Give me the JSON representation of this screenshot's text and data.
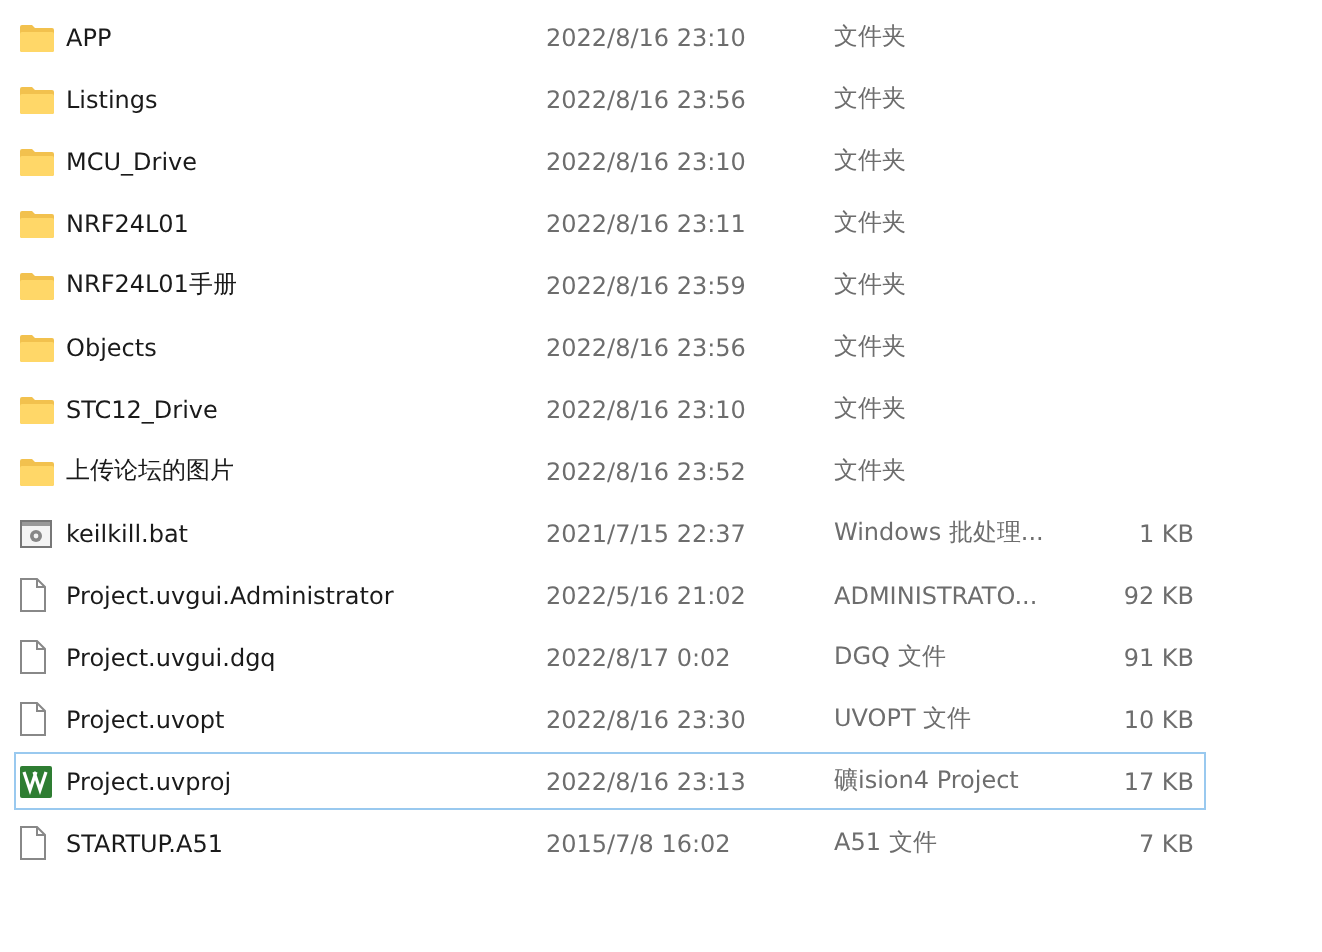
{
  "files": [
    {
      "kind": "folder",
      "name": "APP",
      "date": "2022/8/16 23:10",
      "type": "文件夹",
      "focused": false
    },
    {
      "kind": "folder",
      "name": "Listings",
      "date": "2022/8/16 23:56",
      "type": "文件夹",
      "focused": false
    },
    {
      "kind": "folder",
      "name": "MCU_Drive",
      "date": "2022/8/16 23:10",
      "type": "文件夹",
      "focused": false
    },
    {
      "kind": "folder",
      "name": "NRF24L01",
      "date": "2022/8/16 23:11",
      "type": "文件夹",
      "focused": false
    },
    {
      "kind": "folder",
      "name": "NRF24L01手册",
      "date": "2022/8/16 23:59",
      "type": "文件夹",
      "focused": false
    },
    {
      "kind": "folder",
      "name": "Objects",
      "date": "2022/8/16 23:56",
      "type": "文件夹",
      "focused": false
    },
    {
      "kind": "folder",
      "name": "STC12_Drive",
      "date": "2022/8/16 23:10",
      "type": "文件夹",
      "focused": false
    },
    {
      "kind": "folder",
      "name": "上传论坛的图片",
      "date": "2022/8/16 23:52",
      "type": "文件夹",
      "focused": false
    },
    {
      "kind": "batch",
      "name": "keilkill.bat",
      "date": "2021/7/15 22:37",
      "type": "Windows 批处理...",
      "size": "1 KB",
      "focused": false
    },
    {
      "kind": "file",
      "name": "Project.uvgui.Administrator",
      "date": "2022/5/16 21:02",
      "type": "ADMINISTRATO...",
      "size": "92 KB",
      "focused": false
    },
    {
      "kind": "file",
      "name": "Project.uvgui.dgq",
      "date": "2022/8/17 0:02",
      "type": "DGQ 文件",
      "size": "91 KB",
      "focused": false
    },
    {
      "kind": "file",
      "name": "Project.uvopt",
      "date": "2022/8/16 23:30",
      "type": "UVOPT 文件",
      "size": "10 KB",
      "focused": false
    },
    {
      "kind": "project",
      "name": "Project.uvproj",
      "date": "2022/8/16 23:13",
      "type": "礦ision4 Project",
      "size": "17 KB",
      "focused": true
    },
    {
      "kind": "file",
      "name": "STARTUP.A51",
      "date": "2015/7/8 16:02",
      "type": "A51 文件",
      "size": "7 KB",
      "focused": false
    }
  ]
}
